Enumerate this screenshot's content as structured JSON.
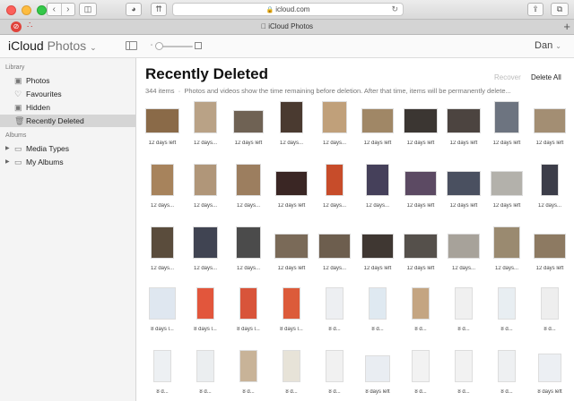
{
  "browser": {
    "address": "icloud.com",
    "tab_title": "iCloud Photos",
    "back": "‹",
    "forward": "›",
    "add_tab": "+"
  },
  "app": {
    "brand": "iCloud",
    "section": "Photos",
    "user": "Dan"
  },
  "sidebar": {
    "library_header": "Library",
    "library_items": [
      {
        "label": "Photos",
        "icon": "photos-icon"
      },
      {
        "label": "Favourites",
        "icon": "heart-icon"
      },
      {
        "label": "Hidden",
        "icon": "hidden-icon"
      },
      {
        "label": "Recently Deleted",
        "icon": "trash-icon"
      }
    ],
    "albums_header": "Albums",
    "album_items": [
      {
        "label": "Media Types"
      },
      {
        "label": "My Albums"
      }
    ]
  },
  "main": {
    "title": "Recently Deleted",
    "recover": "Recover",
    "delete_all": "Delete All",
    "item_count": "344 items",
    "note": "Photos and videos show the time remaining before deletion. After that time, items will be permanently delete..."
  },
  "colors": {
    "accent_red": "#e0433b",
    "sidebar_selected": "#d5d5d5"
  },
  "grid": [
    [
      {
        "cap": "12 days left",
        "color": "#8a6a48"
      },
      {
        "cap": "12 days...",
        "color": "#b9a286"
      },
      {
        "cap": "12 days left",
        "color": "#6f6254"
      },
      {
        "cap": "12 days...",
        "color": "#4a3a30"
      },
      {
        "cap": "12 days...",
        "color": "#c0a07a"
      },
      {
        "cap": "12 days left",
        "color": "#a08766"
      },
      {
        "cap": "12 days left",
        "color": "#3b3632"
      },
      {
        "cap": "12 days left",
        "color": "#4c4440"
      },
      {
        "cap": "12 days left",
        "color": "#6d7480"
      },
      {
        "cap": "12 days left",
        "color": "#a38e73"
      }
    ],
    [
      {
        "cap": "12 days...",
        "color": "#a7835c"
      },
      {
        "cap": "12 days...",
        "color": "#b09679"
      },
      {
        "cap": "12 days...",
        "color": "#9c7e5f"
      },
      {
        "cap": "12 days left",
        "color": "#3a2624"
      },
      {
        "cap": "12 days...",
        "color": "#c74c2a"
      },
      {
        "cap": "12 days...",
        "color": "#45405a"
      },
      {
        "cap": "12 days left",
        "color": "#5c4a63"
      },
      {
        "cap": "12 days left",
        "color": "#4a5060"
      },
      {
        "cap": "12 days left",
        "color": "#b3b1ab"
      },
      {
        "cap": "12 days...",
        "color": "#3c3d49"
      }
    ],
    [
      {
        "cap": "12 days...",
        "color": "#5a4c3c"
      },
      {
        "cap": "12 days...",
        "color": "#404452"
      },
      {
        "cap": "12 days...",
        "color": "#4b4b4b"
      },
      {
        "cap": "12 days left",
        "color": "#7a6a58"
      },
      {
        "cap": "12 days...",
        "color": "#6d5e4e"
      },
      {
        "cap": "12 days left",
        "color": "#3f3732"
      },
      {
        "cap": "12 days left",
        "color": "#55504b"
      },
      {
        "cap": "12 days...",
        "color": "#a7a29a"
      },
      {
        "cap": "12 days...",
        "color": "#9a8a70"
      },
      {
        "cap": "12 days left",
        "color": "#8d7a62"
      }
    ],
    [
      {
        "cap": "8 days l...",
        "color": "#dfe7f0"
      },
      {
        "cap": "8 days l...",
        "color": "#e2563c"
      },
      {
        "cap": "8 days l...",
        "color": "#d8543a"
      },
      {
        "cap": "8 days l...",
        "color": "#dc5b3a"
      },
      {
        "cap": "8 d...",
        "color": "#edeff2"
      },
      {
        "cap": "8 d...",
        "color": "#dfe9f1"
      },
      {
        "cap": "8 d...",
        "color": "#c4a582"
      },
      {
        "cap": "8 d...",
        "color": "#f0f0f0"
      },
      {
        "cap": "8 d...",
        "color": "#e8eef2"
      },
      {
        "cap": "8 d...",
        "color": "#eeeeee"
      }
    ],
    [
      {
        "cap": "8 d...",
        "color": "#edf0f3"
      },
      {
        "cap": "8 d...",
        "color": "#ebeef0"
      },
      {
        "cap": "8 d...",
        "color": "#c8b398"
      },
      {
        "cap": "8 d...",
        "color": "#e7e3d8"
      },
      {
        "cap": "8 d...",
        "color": "#f1f1f1"
      },
      {
        "cap": "8 days left",
        "color": "#e9edf2"
      },
      {
        "cap": "8 d...",
        "color": "#f2f2f2"
      },
      {
        "cap": "8 d...",
        "color": "#f2f2f2"
      },
      {
        "cap": "8 d...",
        "color": "#eef0f2"
      },
      {
        "cap": "8 days left",
        "color": "#eceff3"
      }
    ]
  ]
}
